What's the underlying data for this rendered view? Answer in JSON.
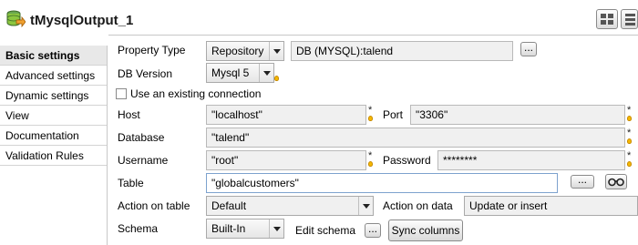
{
  "title": "tMysqlOutput_1",
  "sidebar": {
    "items": [
      {
        "label": "Basic settings",
        "active": true
      },
      {
        "label": "Advanced settings"
      },
      {
        "label": "Dynamic settings"
      },
      {
        "label": "View"
      },
      {
        "label": "Documentation"
      },
      {
        "label": "Validation Rules"
      }
    ]
  },
  "form": {
    "property_type": {
      "label": "Property Type",
      "value": "Repository",
      "repository": "DB (MYSQL):talend",
      "button": "..."
    },
    "db_version": {
      "label": "DB Version",
      "value": "Mysql 5"
    },
    "existing_connection": {
      "label": "Use an existing connection",
      "checked": false
    },
    "host": {
      "label": "Host",
      "value": "\"localhost\""
    },
    "port": {
      "label": "Port",
      "value": "\"3306\""
    },
    "database": {
      "label": "Database",
      "value": "\"talend\""
    },
    "username": {
      "label": "Username",
      "value": "\"root\""
    },
    "password": {
      "label": "Password",
      "value": "********"
    },
    "table": {
      "label": "Table",
      "value": "\"globalcustomers\"",
      "button": "...",
      "binoculars_icon": "binoculars-icon"
    },
    "action_on_table": {
      "label": "Action on table",
      "value": "Default"
    },
    "action_on_data": {
      "label": "Action on data",
      "value": "Update or insert"
    },
    "schema": {
      "label": "Schema",
      "value": "Built-In",
      "edit_label": "Edit schema",
      "edit_button": "...",
      "sync_button": "Sync columns"
    },
    "required_mark": "*"
  },
  "colors": {
    "accent": "#7da2ce",
    "field_bg": "#f0f0f0",
    "bulb": "#f5b800"
  }
}
